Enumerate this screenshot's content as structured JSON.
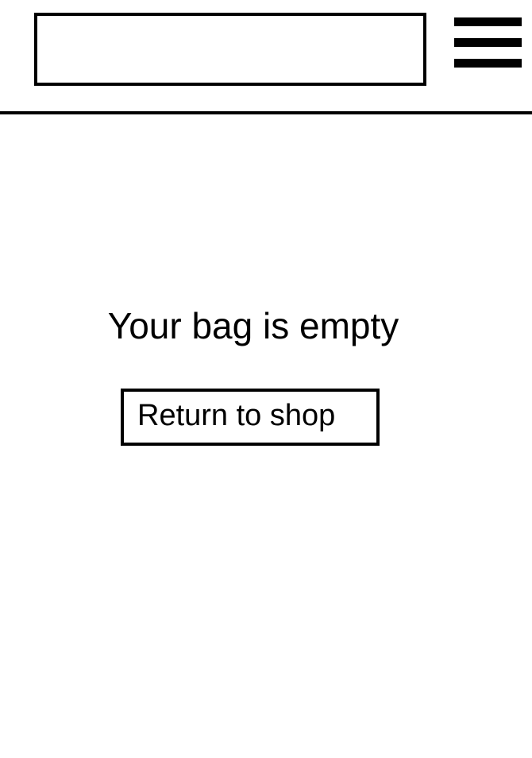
{
  "header": {
    "menu_icon": "hamburger-menu-icon"
  },
  "main": {
    "empty_message": "Your bag is empty",
    "return_button_label": "Return to shop"
  }
}
